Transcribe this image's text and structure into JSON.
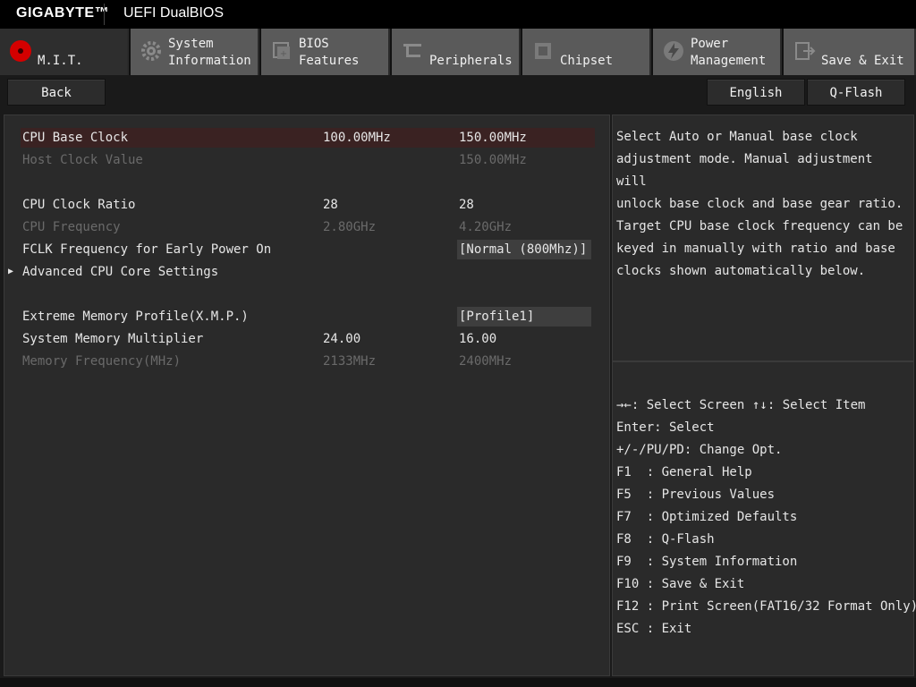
{
  "brand": {
    "logo": "GIGABYTE™",
    "product": "UEFI DualBIOS"
  },
  "tabs": [
    {
      "label": "M.I.T.",
      "icon": "mit-icon",
      "active": true
    },
    {
      "label": "System\nInformation",
      "icon": "gear-icon",
      "active": false
    },
    {
      "label": "BIOS\nFeatures",
      "icon": "bios-features-icon",
      "active": false
    },
    {
      "label": "Peripherals",
      "icon": "peripherals-icon",
      "active": false
    },
    {
      "label": "Chipset",
      "icon": "chipset-icon",
      "active": false
    },
    {
      "label": "Power\nManagement",
      "icon": "power-icon",
      "active": false
    },
    {
      "label": "Save & Exit",
      "icon": "exit-icon",
      "active": false
    }
  ],
  "buttons": {
    "back": "Back",
    "language": "English",
    "qflash": "Q-Flash"
  },
  "settings": [
    {
      "label": "CPU Base Clock",
      "current": "100.00MHz",
      "value": "150.00MHz",
      "selected": true,
      "dim": false
    },
    {
      "label": "Host Clock Value",
      "current": "",
      "value": "150.00MHz",
      "dim": true
    },
    {
      "label": "CPU Clock Ratio",
      "current": "28",
      "value": "28",
      "dim": false
    },
    {
      "label": "CPU Frequency",
      "current": "2.80GHz",
      "value": "4.20GHz",
      "dim": true
    },
    {
      "label": "FCLK Frequency for Early Power On",
      "current": "",
      "value": "[Normal (800Mhz)]",
      "boxed": true,
      "dim": false
    },
    {
      "label": "Advanced CPU Core Settings",
      "submenu": true,
      "dim": false
    },
    {
      "label": "Extreme Memory Profile(X.M.P.)",
      "current": "",
      "value": "[Profile1]",
      "boxed": true,
      "dim": false
    },
    {
      "label": "System Memory Multiplier",
      "current": "24.00",
      "value": "16.00",
      "dim": false
    },
    {
      "label": "Memory Frequency(MHz)",
      "current": "2133MHz",
      "value": "2400MHz",
      "dim": true
    }
  ],
  "help": "Select Auto or Manual base clock\nadjustment mode. Manual adjustment will\nunlock base clock and base gear ratio.\nTarget CPU base clock frequency can be\nkeyed in manually with ratio and base\nclocks shown automatically below.",
  "keys": {
    "select_screen": "→←: Select Screen",
    "select_item": "↑↓: Select Item",
    "lines": [
      "Enter: Select",
      "+/-/PU/PD: Change Opt.",
      "F1  : General Help",
      "F5  : Previous Values",
      "F7  : Optimized Defaults",
      "F8  : Q-Flash",
      "F9  : System Information",
      "F10 : Save & Exit",
      "F12 : Print Screen(FAT16/32 Format Only)",
      "ESC : Exit"
    ]
  }
}
